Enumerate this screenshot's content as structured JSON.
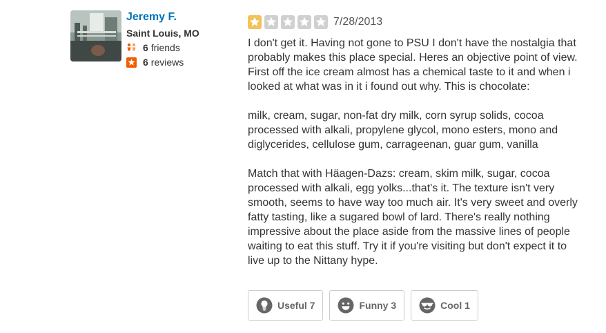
{
  "user": {
    "name": "Jeremy F.",
    "location": "Saint Louis, MO",
    "friends_count": "6",
    "friends_label": "friends",
    "reviews_count": "6",
    "reviews_label": "reviews"
  },
  "review": {
    "rating": 1,
    "max_rating": 5,
    "date": "7/28/2013",
    "paragraphs": [
      "I don't get it. Having not gone to PSU I don't have the nostalgia that probably makes this place special. Heres an objective point of view. First off the ice cream almost has a chemical taste to it and when i looked at what was in it i found out why. This is chocolate:",
      "milk, cream, sugar, non-fat dry milk, corn syrup solids, cocoa processed with alkali, propylene glycol, mono esters, mono and diglycerides, cellulose gum, carrageenan, guar gum, vanilla",
      "Match that with Häagen-Dazs: cream, skim milk, sugar, cocoa processed with alkali, egg yolks...that's it. The texture isn't very smooth, seems to have way too much air. It's very sweet and overly fatty tasting, like a sugared bowl of lard. There's really nothing impressive about the place aside from the massive lines of people waiting to eat this stuff. Try it if you're visiting but don't expect it to live up to the Nittany hype."
    ]
  },
  "votes": {
    "useful_label": "Useful 7",
    "funny_label": "Funny 3",
    "cool_label": "Cool 1"
  },
  "colors": {
    "name_link": "#0073bb",
    "star_on": "#f0c35b",
    "star_off": "#d0d0d0",
    "friends_icon": "#f15c00",
    "reviews_icon": "#f15c00"
  },
  "icons": {
    "friends": "friends-icon",
    "reviews": "review-star-icon",
    "useful": "lightbulb-icon",
    "funny": "smiley-icon",
    "cool": "sunglasses-face-icon"
  }
}
